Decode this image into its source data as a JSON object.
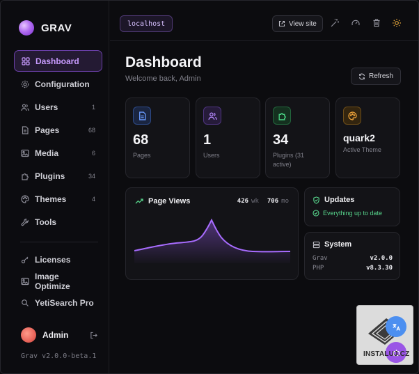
{
  "brand": {
    "name": "GRAV"
  },
  "sidebar": {
    "items": [
      {
        "label": "Dashboard",
        "icon": "dashboard-icon",
        "count": ""
      },
      {
        "label": "Configuration",
        "icon": "gear-icon",
        "count": ""
      },
      {
        "label": "Users",
        "icon": "users-icon",
        "count": "1"
      },
      {
        "label": "Pages",
        "icon": "page-icon",
        "count": "68"
      },
      {
        "label": "Media",
        "icon": "image-icon",
        "count": "6"
      },
      {
        "label": "Plugins",
        "icon": "puzzle-icon",
        "count": "34"
      },
      {
        "label": "Themes",
        "icon": "palette-icon",
        "count": "4"
      },
      {
        "label": "Tools",
        "icon": "wrench-icon",
        "count": ""
      }
    ],
    "extras": [
      {
        "label": "Licenses",
        "icon": "key-icon"
      },
      {
        "label": "Image Optimize",
        "icon": "image-icon"
      },
      {
        "label": "YetiSearch Pro",
        "icon": "search-icon"
      }
    ],
    "user": {
      "name": "Admin"
    },
    "version": "Grav v2.0.0-beta.1"
  },
  "topbar": {
    "host": "localhost",
    "view_site": "View site"
  },
  "main": {
    "title": "Dashboard",
    "subtitle": "Welcome back, Admin",
    "refresh": "Refresh",
    "stats": [
      {
        "value": "68",
        "label": "Pages",
        "color": "#5b8dff"
      },
      {
        "value": "1",
        "label": "Users",
        "color": "#b07cff"
      },
      {
        "value": "34",
        "label": "Plugins (31 active)",
        "color": "#43d17f"
      },
      {
        "value": "quark2",
        "label": "Active Theme",
        "color": "#f0a43a"
      }
    ],
    "page_views": {
      "title": "Page Views",
      "week_value": "426",
      "week_unit": "wk",
      "month_value": "706",
      "month_unit": "mo"
    },
    "updates": {
      "title": "Updates",
      "status": "Everything up to date"
    },
    "system": {
      "title": "System",
      "rows": [
        {
          "key": "Grav",
          "value": "v2.0.0"
        },
        {
          "key": "PHP",
          "value": "v8.3.30"
        }
      ]
    }
  },
  "watermark": {
    "text": "INSTALUJ.CZ"
  },
  "colors": {
    "accent": "#b07cff",
    "success": "#58d68d"
  }
}
